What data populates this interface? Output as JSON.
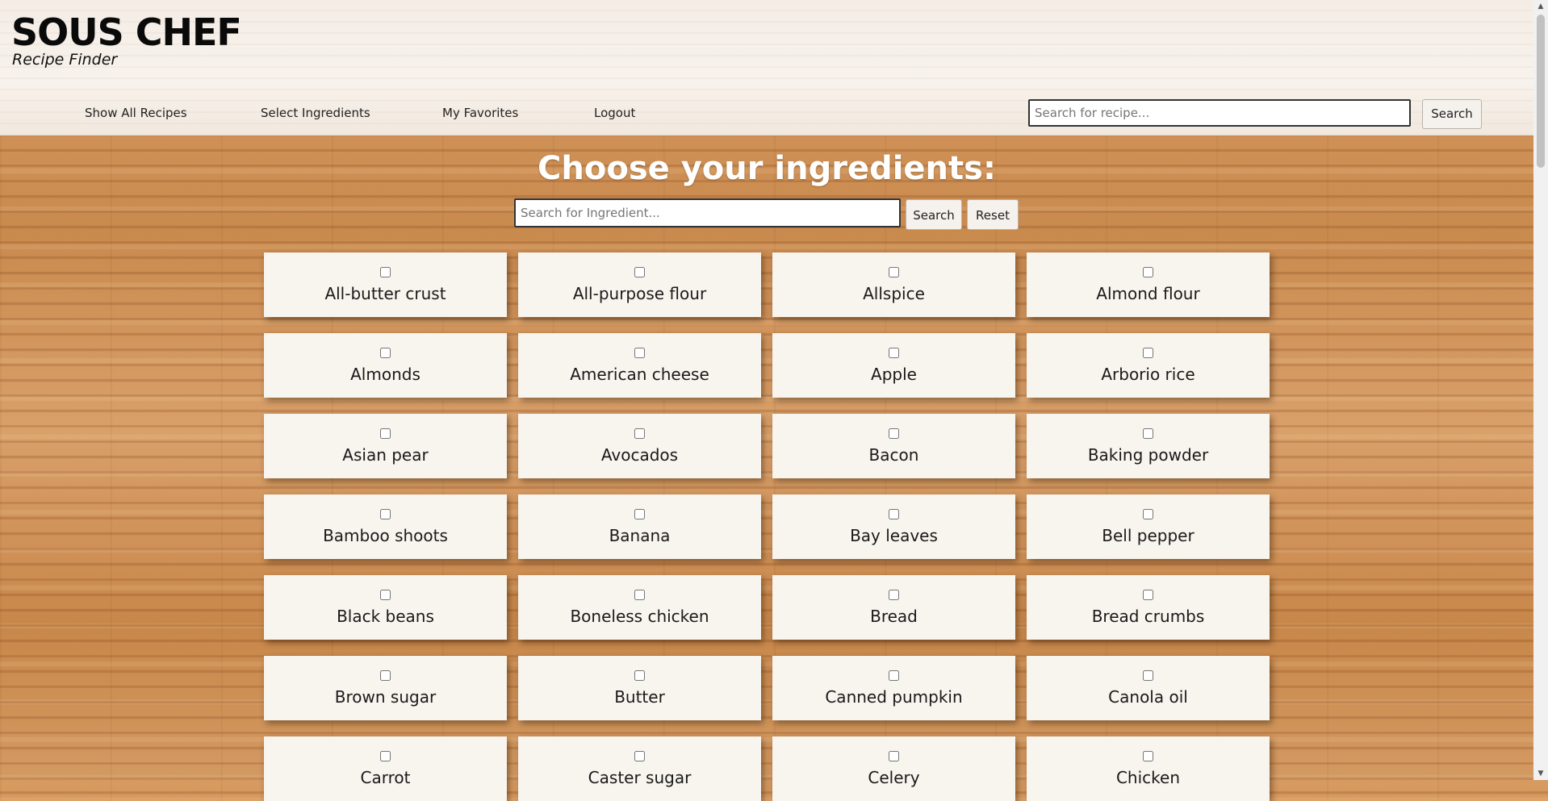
{
  "brand": {
    "title": "SOUS CHEF",
    "subtitle": "Recipe Finder"
  },
  "nav": [
    {
      "label": "Show All Recipes"
    },
    {
      "label": "Select Ingredients"
    },
    {
      "label": "My Favorites"
    },
    {
      "label": "Logout"
    }
  ],
  "recipe_search": {
    "placeholder": "Search for recipe...",
    "button": "Search"
  },
  "main": {
    "heading": "Choose your ingredients:",
    "search": {
      "placeholder": "Search for Ingredient...",
      "search_button": "Search",
      "reset_button": "Reset"
    }
  },
  "ingredients": [
    "All-butter crust",
    "All-purpose flour",
    "Allspice",
    "Almond flour",
    "Almonds",
    "American cheese",
    "Apple",
    "Arborio rice",
    "Asian pear",
    "Avocados",
    "Bacon",
    "Baking powder",
    "Bamboo shoots",
    "Banana",
    "Bay leaves",
    "Bell pepper",
    "Black beans",
    "Boneless chicken",
    "Bread",
    "Bread crumbs",
    "Brown sugar",
    "Butter",
    "Canned pumpkin",
    "Canola oil",
    "Carrot",
    "Caster sugar",
    "Celery",
    "Chicken"
  ],
  "colors": {
    "card_bg": "#f8f4ee",
    "heading": "#ffffff",
    "header_bg": "#f4ede6"
  }
}
